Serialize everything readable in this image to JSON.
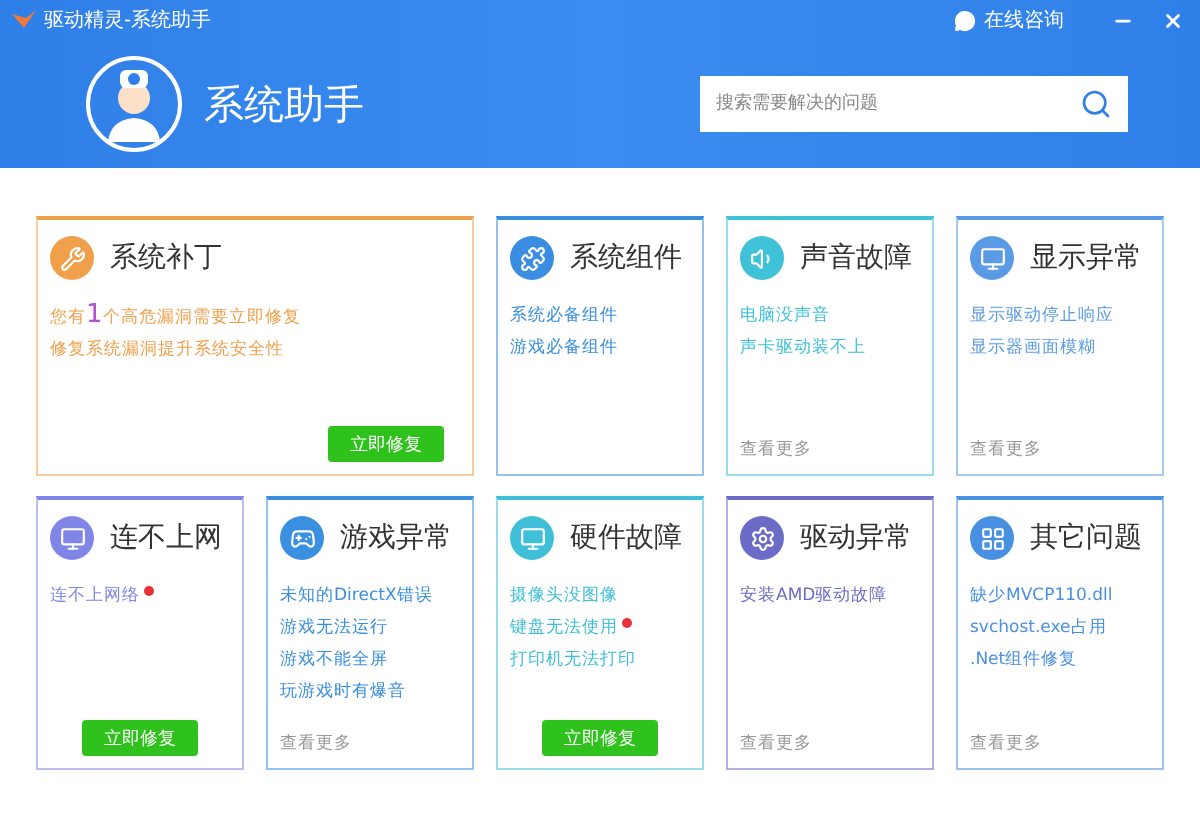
{
  "window": {
    "title": "驱动精灵-系统助手",
    "consult": "在线咨询"
  },
  "header": {
    "title": "系统助手",
    "search": {
      "placeholder": "搜索需要解决的问题"
    }
  },
  "cards": [
    {
      "kind": "wide",
      "title": "系统补丁",
      "color": "#f0a04b",
      "lines": [
        {
          "text": "您有**1**个高危漏洞需要立即修复",
          "alert": false
        },
        {
          "text": "修复系统漏洞提升系统安全性",
          "alert": false
        }
      ],
      "button": "立即修复"
    },
    {
      "kind": "normal",
      "title": "系统组件",
      "color": "#3a8de0",
      "lines": [
        {
          "text": "系统必备组件",
          "alert": false
        },
        {
          "text": "游戏必备组件",
          "alert": false
        }
      ]
    },
    {
      "kind": "normal",
      "title": "声音故障",
      "color": "#3fc2d8",
      "lines": [
        {
          "text": "电脑没声音",
          "alert": false
        },
        {
          "text": "声卡驱动装不上",
          "alert": false
        }
      ],
      "more": "查看更多"
    },
    {
      "kind": "normal",
      "title": "显示异常",
      "color": "#5b9be6",
      "lines": [
        {
          "text": "显示驱动停止响应",
          "alert": false
        },
        {
          "text": "显示器画面模糊",
          "alert": false
        }
      ],
      "more": "查看更多"
    },
    {
      "kind": "normal",
      "title": "连不上网",
      "color": "#7f86e8",
      "lines": [
        {
          "text": "连不上网络",
          "alert": true
        }
      ],
      "button": "立即修复"
    },
    {
      "kind": "normal",
      "title": "游戏异常",
      "color": "#3b8fe0",
      "lines": [
        {
          "text": "未知的DirectX错误",
          "alert": false
        },
        {
          "text": "游戏无法运行",
          "alert": false
        },
        {
          "text": "游戏不能全屏",
          "alert": false
        },
        {
          "text": "玩游戏时有爆音",
          "alert": false
        }
      ],
      "more": "查看更多"
    },
    {
      "kind": "normal",
      "title": "硬件故障",
      "color": "#3fc0d8",
      "lines": [
        {
          "text": "摄像头没图像",
          "alert": false
        },
        {
          "text": "键盘无法使用",
          "alert": true
        },
        {
          "text": "打印机无法打印",
          "alert": false
        }
      ],
      "button": "立即修复"
    },
    {
      "kind": "normal",
      "title": "驱动异常",
      "color": "#6c6cc8",
      "lines": [
        {
          "text": "安装AMD驱动故障",
          "alert": false
        }
      ],
      "more": "查看更多"
    },
    {
      "kind": "normal",
      "title": "其它问题",
      "color": "#4a90e2",
      "lines": [
        {
          "text": "缺少MVCP110.dll",
          "alert": false
        },
        {
          "text": "svchost.exe占用",
          "alert": false
        },
        {
          "text": ".Net组件修复",
          "alert": false
        }
      ],
      "more": "查看更多"
    }
  ]
}
